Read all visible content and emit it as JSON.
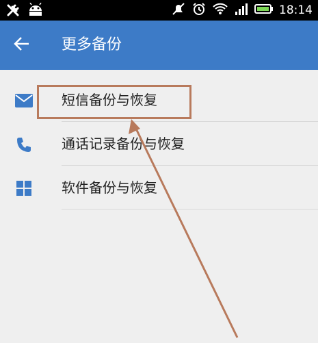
{
  "status_bar": {
    "time": "18:14",
    "icons": [
      "tools-icon",
      "android-icon",
      "mute-icon",
      "alarm-icon",
      "wifi-icon",
      "signal-icon",
      "battery-icon"
    ]
  },
  "action_bar": {
    "title": "更多备份",
    "back_icon": "arrow-left-icon",
    "background": "#3d7bc7"
  },
  "list": {
    "items": [
      {
        "label": "短信备份与恢复",
        "icon": "mail-icon"
      },
      {
        "label": "通话记录备份与恢复",
        "icon": "phone-icon"
      },
      {
        "label": "软件备份与恢复",
        "icon": "apps-grid-icon"
      }
    ]
  },
  "colors": {
    "accent": "#3d7bc7",
    "annotation": "#b87a5c",
    "background": "#efefef"
  }
}
